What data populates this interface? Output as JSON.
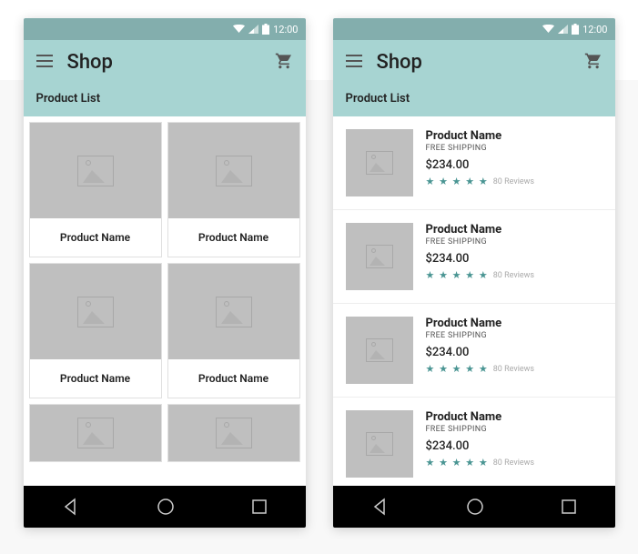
{
  "status": {
    "time": "12:00"
  },
  "appbar": {
    "title": "Shop"
  },
  "section": {
    "title": "Product List"
  },
  "grid": {
    "items": [
      {
        "name": "Product Name"
      },
      {
        "name": "Product Name"
      },
      {
        "name": "Product Name"
      },
      {
        "name": "Product Name"
      }
    ]
  },
  "list": {
    "items": [
      {
        "name": "Product Name",
        "shipping": "FREE SHIPPING",
        "price": "$234.00",
        "stars": "★ ★ ★ ★ ★",
        "reviews": "80 Reviews"
      },
      {
        "name": "Product Name",
        "shipping": "FREE SHIPPING",
        "price": "$234.00",
        "stars": "★ ★ ★ ★ ★",
        "reviews": "80 Reviews"
      },
      {
        "name": "Product Name",
        "shipping": "FREE SHIPPING",
        "price": "$234.00",
        "stars": "★ ★ ★ ★ ★",
        "reviews": "80 Reviews"
      },
      {
        "name": "Product Name",
        "shipping": "FREE SHIPPING",
        "price": "$234.00",
        "stars": "★ ★ ★ ★ ★",
        "reviews": "80 Reviews"
      }
    ]
  },
  "colors": {
    "accent": "#4a9593",
    "header": "#a7d4d2",
    "statusbar": "#83aead"
  }
}
